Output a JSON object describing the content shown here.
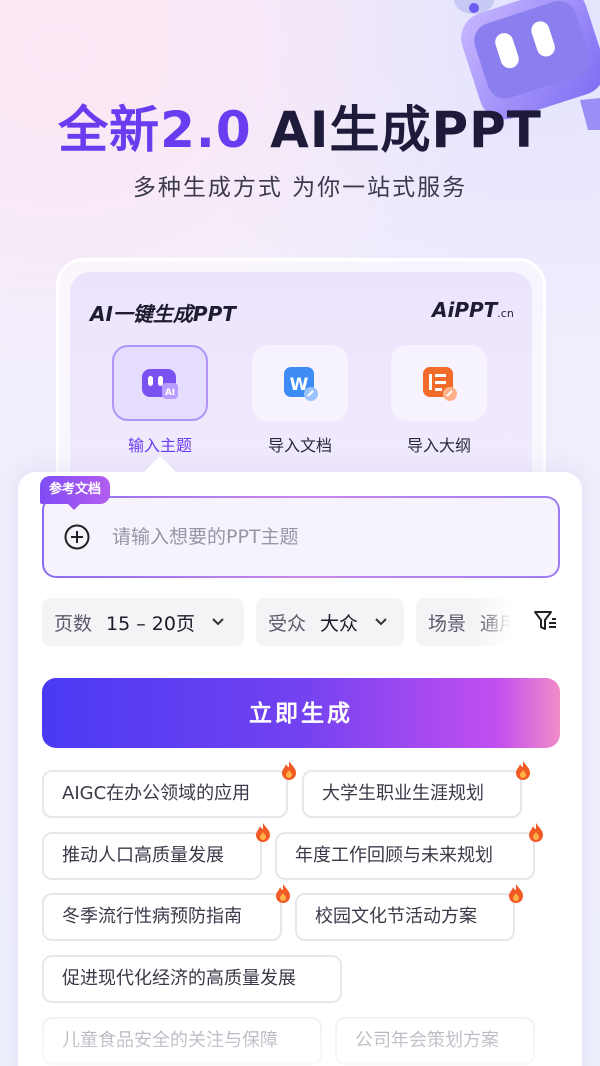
{
  "hero": {
    "title_purple": "全新2.0",
    "title_dark": "AI生成PPT",
    "subtitle": "多种生成方式 为你一站式服务"
  },
  "card": {
    "title": "AI一键生成PPT",
    "brand": "AiPPT",
    "brand_suffix": ".cn",
    "modes": [
      {
        "label": "输入主题",
        "icon": "robot-icon",
        "active": true
      },
      {
        "label": "导入文档",
        "icon": "word-doc-icon",
        "active": false
      },
      {
        "label": "导入大纲",
        "icon": "outline-icon",
        "active": false
      }
    ]
  },
  "input": {
    "tag": "参考文档",
    "placeholder": "请输入想要的PPT主题",
    "value": ""
  },
  "options": {
    "pages": {
      "label": "页数",
      "value": "15 – 20页"
    },
    "audience": {
      "label": "受众",
      "value": "大众"
    },
    "scene": {
      "label": "场景",
      "value": "通用"
    }
  },
  "generate_button": "立即生成",
  "suggestions": [
    {
      "text": "AIGC在办公领域的应用",
      "hot": true
    },
    {
      "text": "大学生职业生涯规划",
      "hot": true
    },
    {
      "text": "推动人口高质量发展",
      "hot": true
    },
    {
      "text": "年度工作回顾与未来规划",
      "hot": true
    },
    {
      "text": "冬季流行性病预防指南",
      "hot": true
    },
    {
      "text": "校园文化节活动方案",
      "hot": true
    },
    {
      "text": "促进现代化经济的高质量发展",
      "hot": false
    },
    {
      "text": "儿童食品安全的关注与保障",
      "hot": false
    },
    {
      "text": "公司年会策划方案",
      "hot": false
    }
  ],
  "colors": {
    "accent_purple": "#6a3cf0",
    "gradient_start": "#4a3af3",
    "gradient_end": "#f08cc8",
    "hot_icon": "#f15a24"
  }
}
